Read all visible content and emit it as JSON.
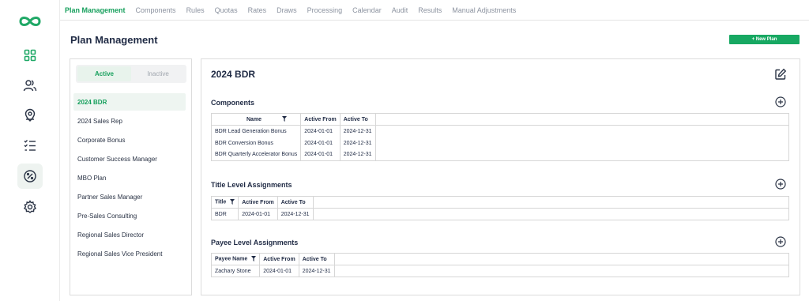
{
  "app": {
    "nav_icons": [
      "infinity-logo-icon",
      "dashboard-grid-icon",
      "users-icon",
      "location-pin-icon",
      "checklist-icon",
      "percent-icon",
      "gear-icon"
    ],
    "accent_color": "#17a862"
  },
  "topnav": {
    "tabs": [
      "Plan Management",
      "Components",
      "Rules",
      "Quotas",
      "Rates",
      "Draws",
      "Processing",
      "Calendar",
      "Audit",
      "Results",
      "Manual Adjustments"
    ],
    "active": "Plan Management"
  },
  "page": {
    "title": "Plan Management",
    "new_plan_label": "+ New Plan"
  },
  "plan_list": {
    "toggle": {
      "active": "Active",
      "inactive": "Inactive"
    },
    "items": [
      "2024 BDR",
      "2024 Sales Rep",
      "Corporate Bonus",
      "Customer Success Manager",
      "MBO Plan",
      "Partner Sales Manager",
      "Pre-Sales Consulting",
      "Regional Sales Director",
      "Regional Sales Vice President"
    ],
    "selected": "2024 BDR"
  },
  "detail": {
    "title": "2024 BDR",
    "components": {
      "title": "Components",
      "columns": [
        "Name",
        "Active From",
        "Active To"
      ],
      "rows": [
        [
          "BDR Lead Generation Bonus",
          "2024-01-01",
          "2024-12-31"
        ],
        [
          "BDR Conversion Bonus",
          "2024-01-01",
          "2024-12-31"
        ],
        [
          "BDR Quarterly Accelerator Bonus",
          "2024-01-01",
          "2024-12-31"
        ]
      ]
    },
    "title_assignments": {
      "title": "Title Level Assignments",
      "columns": [
        "Title",
        "Active From",
        "Active To"
      ],
      "rows": [
        [
          "BDR",
          "2024-01-01",
          "2024-12-31"
        ]
      ]
    },
    "payee_assignments": {
      "title": "Payee Level Assignments",
      "columns": [
        "Payee Name",
        "Active From",
        "Active To"
      ],
      "rows": [
        [
          "Zachary Stone",
          "2024-01-01",
          "2024-12-31"
        ]
      ]
    }
  }
}
